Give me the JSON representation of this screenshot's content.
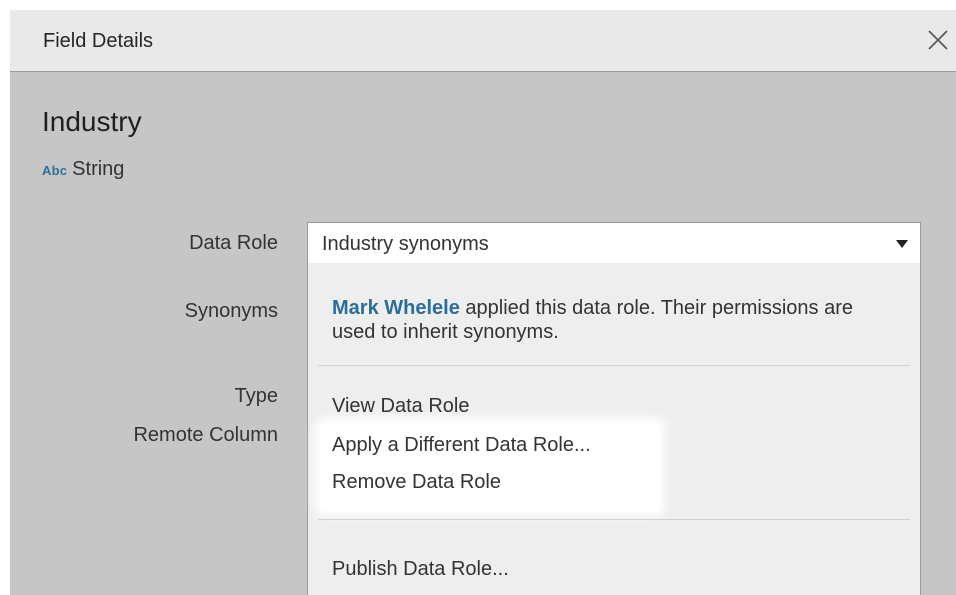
{
  "dialog": {
    "title": "Field Details"
  },
  "field": {
    "name": "Industry",
    "type_icon": "Abc",
    "type_label": "String"
  },
  "labels": {
    "data_role": "Data Role",
    "synonyms": "Synonyms",
    "type": "Type",
    "remote_column": "Remote Column"
  },
  "data_role_select": {
    "value": "Industry synonyms"
  },
  "menu": {
    "info_user": "Mark Whelele",
    "info_text": " applied this data role. Their permissions are used to inherit synonyms.",
    "items": [
      {
        "label": "View Data Role"
      },
      {
        "label": "Apply a Different Data Role..."
      },
      {
        "label": "Remove Data Role"
      },
      {
        "label": "Publish Data Role..."
      }
    ]
  },
  "icons": {
    "close": "close-icon",
    "dropdown": "triangle-down-icon",
    "type": "string-type-icon"
  },
  "colors": {
    "overlay": "#c6c6c6",
    "header": "#e9e9e9",
    "link": "#2a6f97",
    "type_icon": "#2f6e9c"
  }
}
